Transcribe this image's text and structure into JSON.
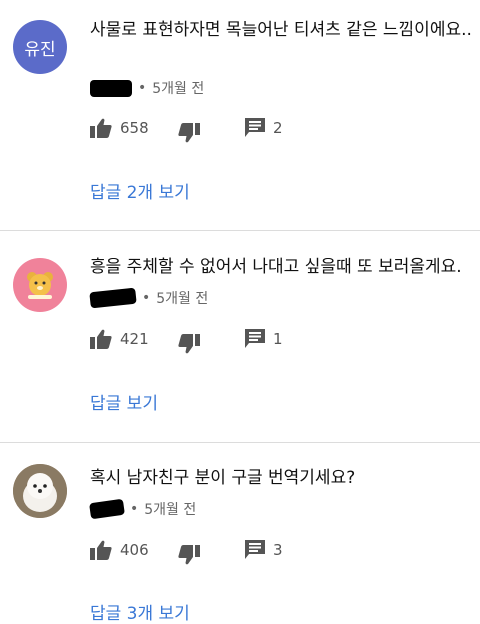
{
  "comments": [
    {
      "avatar_text": "유진",
      "avatar_color": "#5b6bc9",
      "text": "사물로 표현하자면 목늘어난 티셔츠 같은 느낌이에요..",
      "time": "5개월 전",
      "likes": "658",
      "replies": "2",
      "reply_label": "답글 2개 보기"
    },
    {
      "avatar_color": "#f0829a",
      "text": "흥을 주체할 수 없어서 나대고 싶을때 또 보러올게요.",
      "time": "5개월 전",
      "likes": "421",
      "replies": "1",
      "reply_label": "답글 보기"
    },
    {
      "avatar_color": "#b9a58c",
      "text": "혹시 남자친구 분이 구글 번역기세요?",
      "time": "5개월 전",
      "likes": "406",
      "replies": "3",
      "reply_label": "답글 3개 보기"
    }
  ],
  "icons": {
    "like": "thumbs-up-icon",
    "dislike": "thumbs-down-icon",
    "reply": "comment-icon"
  },
  "colors": {
    "link": "#3a78d6",
    "meta": "#666666"
  }
}
